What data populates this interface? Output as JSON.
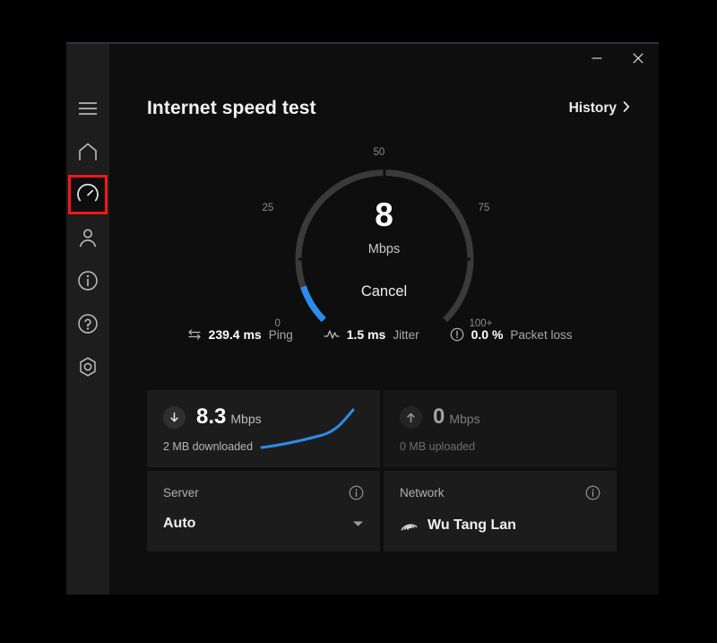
{
  "window": {
    "titlebar": {
      "minimize_icon": "minimize-icon",
      "close_icon": "close-icon"
    }
  },
  "sidebar": {
    "items": [
      {
        "icon": "hamburger-menu-icon",
        "name": "menu"
      },
      {
        "icon": "home-icon",
        "name": "home"
      },
      {
        "icon": "speedometer-icon",
        "name": "speed-test",
        "selected": true
      },
      {
        "icon": "person-icon",
        "name": "account"
      },
      {
        "icon": "info-circle-icon",
        "name": "about"
      },
      {
        "icon": "question-circle-icon",
        "name": "help"
      },
      {
        "icon": "settings-gear-icon",
        "name": "settings"
      }
    ],
    "highlight_color": "#f61717"
  },
  "header": {
    "title": "Internet speed test",
    "history_label": "History",
    "history_chevron": "chevron-right-icon"
  },
  "gauge": {
    "value": "8",
    "unit": "Mbps",
    "action_label": "Cancel",
    "ticks": [
      "0",
      "25",
      "50",
      "75",
      "100+"
    ],
    "progress_color": "#2b8ceb",
    "track_color": "#3a3a3a",
    "max": 100,
    "current": 8
  },
  "stats": [
    {
      "icon": "ping-arrows-icon",
      "value": "239.4 ms",
      "label": "Ping"
    },
    {
      "icon": "jitter-wave-icon",
      "value": "1.5 ms",
      "label": "Jitter"
    },
    {
      "icon": "packet-loss-icon",
      "value": "0.0 %",
      "label": "Packet loss"
    }
  ],
  "cards": {
    "download": {
      "icon": "download-arrow-icon",
      "value": "8.3",
      "unit": "Mbps",
      "sub": "2 MB downloaded",
      "sparkline_color": "#2b8ceb"
    },
    "upload": {
      "icon": "upload-arrow-icon",
      "value": "0",
      "unit": "Mbps",
      "sub": "0 MB uploaded"
    },
    "server": {
      "label": "Server",
      "value": "Auto",
      "info_icon": "info-circle-icon",
      "chevron_icon": "chevron-down-icon"
    },
    "network": {
      "label": "Network",
      "value": "Wu Tang Lan",
      "info_icon": "info-circle-icon",
      "wifi_icon": "wifi-icon"
    }
  }
}
